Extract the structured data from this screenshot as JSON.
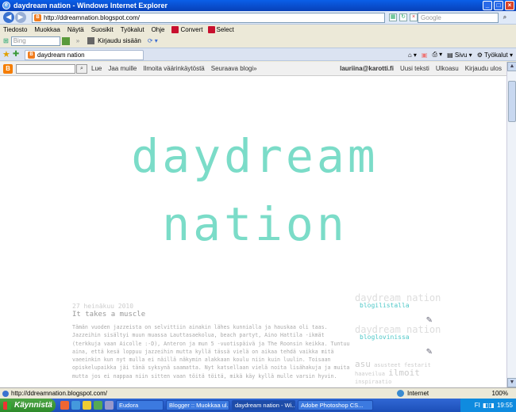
{
  "window": {
    "title": "daydream nation - Windows Internet Explorer"
  },
  "address": {
    "url": "http://ddreamnation.blogspot.com/",
    "search_placeholder": "Google"
  },
  "menu": {
    "items": [
      "Tiedosto",
      "Muokkaa",
      "Näytä",
      "Suosikit",
      "Työkalut",
      "Ohje"
    ],
    "convert_label": "Convert",
    "select_label": "Select"
  },
  "bing": {
    "placeholder": "Bing",
    "signin_label": "Kirjaudu sisään"
  },
  "tab": {
    "label": "daydream nation"
  },
  "commands": {
    "page_label": "Sivu",
    "tools_label": "Työkalut"
  },
  "blogger": {
    "left_links": [
      "Lue",
      "Jaa muille",
      "Ilmoita väärinkäytöstä",
      "Seuraava blogi»"
    ],
    "email": "lauriina@karotti.fi",
    "right_links": [
      "Uusi teksti",
      "Ulkoasu",
      "Kirjaudu ulos"
    ]
  },
  "blog": {
    "title_line1": "daydream",
    "title_line2": "nation",
    "post_date": "27 heinäkuu 2010",
    "post_title": "It takes a muscle",
    "post_body": "Tämän vuoden jazzeista on selvittiin ainakin lähes kunnialla ja hauskaa oli taas. Jazzeihin sisältyi muun muassa Lauttasaekolua, beach partyt, Aino Hattila -ikmät (terkkuja vaan Aicolle :-D), Anteron ja mun 5 -vuotispäivä ja The Roonsin keikka. Tuntuu aina, että kesä loppuu jazzeihin mutta kyllä tässä vielä on aikaa tehdä vaikka mitä vaeeinkin kun nyt mulla ei näillä näkymin alakkaan koulu niin kuin luulin. Toisaan opiskelupaikka jäi tänä syksynä saamatta. Nyt katsellaan vielä noita lisähakuja ja muita mutta jos ei nappaa niin sitten vaan töitä töitä, mikä käy kyllä mulle varsin hyvin.",
    "badge1_back": "daydream nation",
    "badge1_front": "blogilistalla",
    "badge2_back": "daydream nation",
    "badge2_front": "bloglovinissa",
    "tags": [
      "asu",
      "asusteet",
      "festarit",
      "haaveilua",
      "ilmoit",
      "inspiraatio"
    ]
  },
  "status": {
    "url": "http://ddreamnation.blogspot.com/",
    "zone": "Internet",
    "zoom": "100%"
  },
  "taskbar": {
    "start_label": "Käynnistä",
    "tasks": [
      "Eudora",
      "Blogger :: Muokkaa ul...",
      "daydream nation - Wi...",
      "Adobe Photoshop CS..."
    ],
    "lang": "FI",
    "clock": "19:55"
  }
}
